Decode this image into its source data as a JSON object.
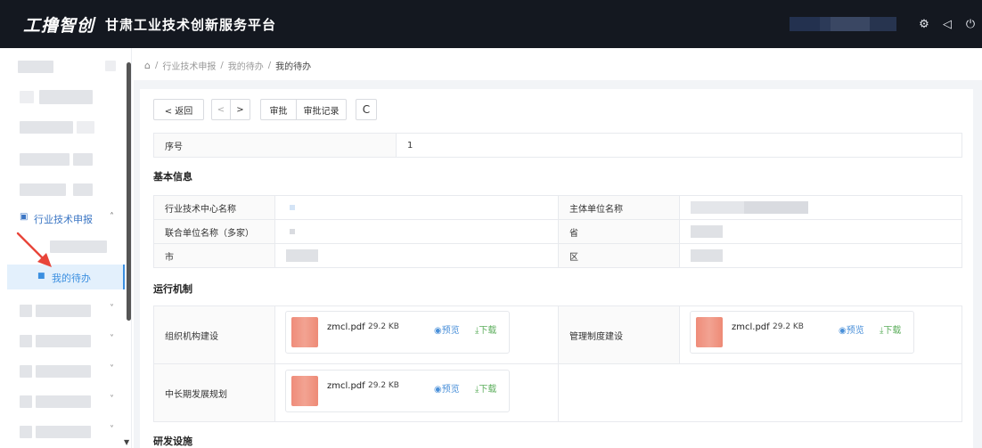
{
  "header": {
    "logo": "工撸智创",
    "title": "甘肃工业技术创新服务平台",
    "icons": [
      "gear-icon",
      "megaphone-icon",
      "power-icon"
    ]
  },
  "sidebar": {
    "active_parent": "行业技术申报",
    "active_child": "我的待办"
  },
  "breadcrumb": {
    "items": [
      "行业技术申报",
      "我的待办",
      "我的待办"
    ]
  },
  "toolbar": {
    "back": "< 返回",
    "prev": "<",
    "next": ">",
    "approve": "审批",
    "record": "审批记录",
    "refresh": "C"
  },
  "serial": {
    "label": "序号",
    "value": "1"
  },
  "basic_info": {
    "title": "基本信息",
    "rows": [
      {
        "l1": "行业技术中心名称",
        "l2": "主体单位名称"
      },
      {
        "l1": "联合单位名称（多家）",
        "l2": "省"
      },
      {
        "l1": "市",
        "l2": "区"
      }
    ]
  },
  "mechanism": {
    "title": "运行机制",
    "org_label": "组织机构建设",
    "mgmt_label": "管理制度建设",
    "plan_label": "中长期发展规划",
    "file": {
      "name": "zmcl.pdf",
      "size": "29.2 KB",
      "preview": "预览",
      "download": "下载"
    }
  },
  "facilities": {
    "title": "研发设施"
  },
  "colors": {
    "accent": "#3b8fe0",
    "topbar": "#141820",
    "download": "#5cae5c"
  }
}
